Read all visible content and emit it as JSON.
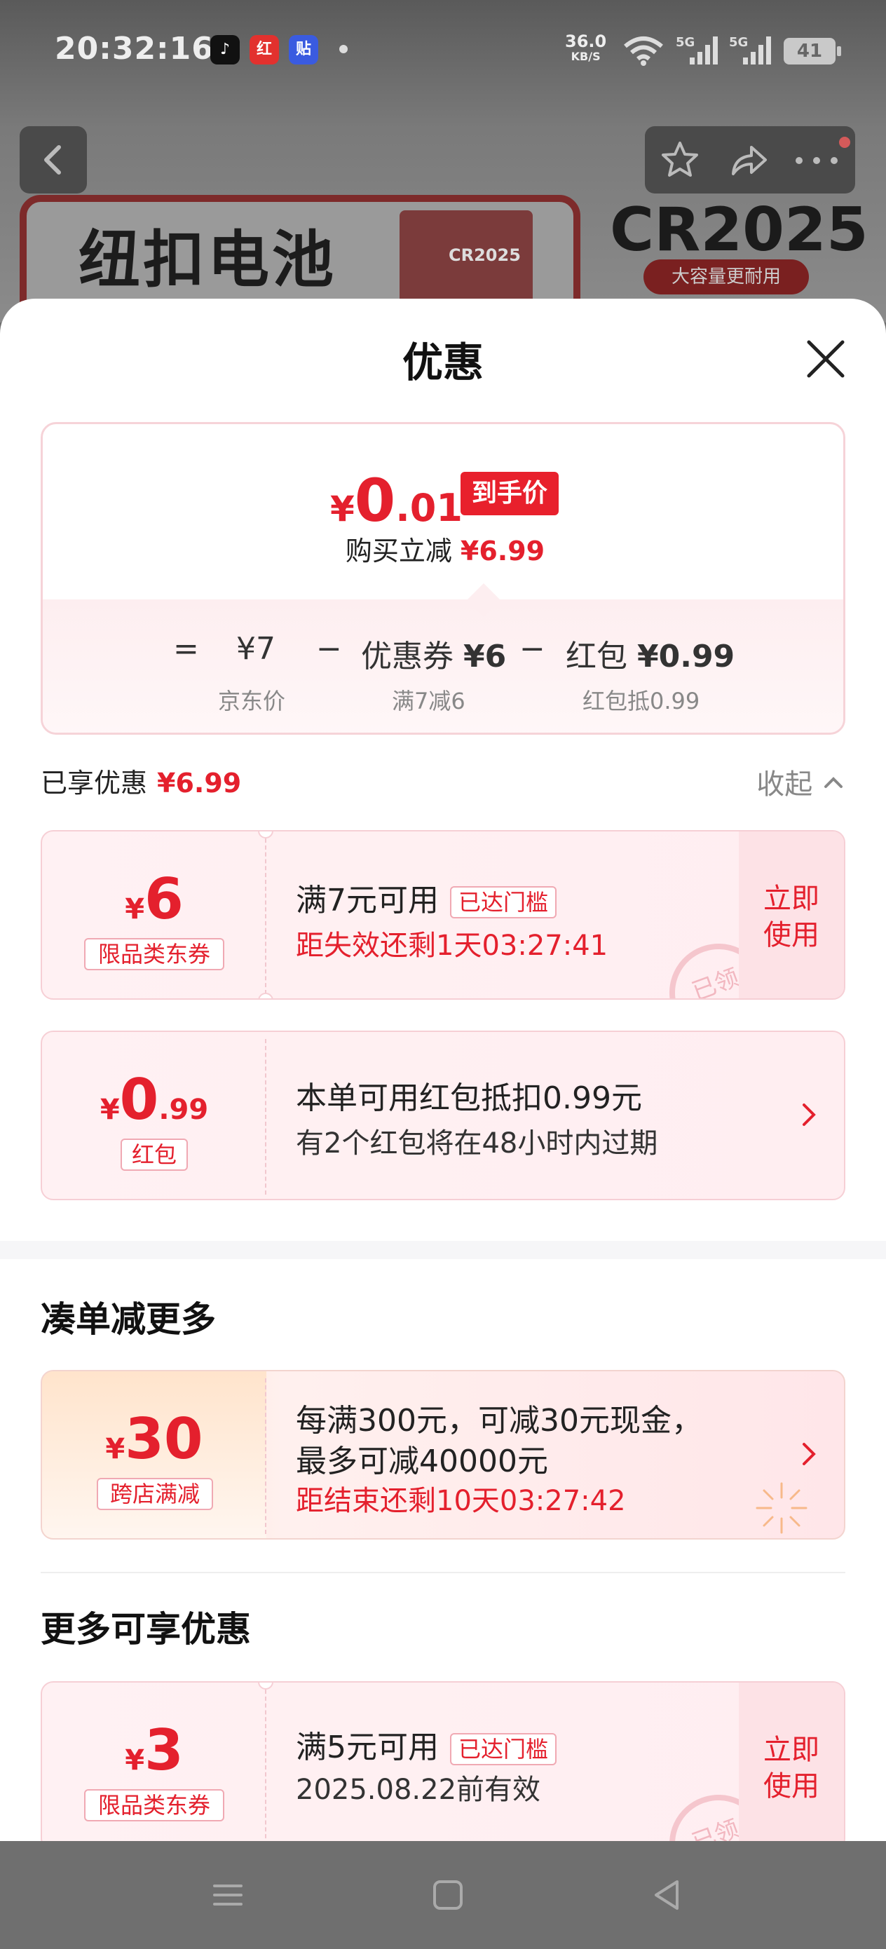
{
  "status_bar": {
    "time": "20:32:16",
    "apps": [
      {
        "name": "douyin-icon",
        "glyph": "♪",
        "color": "#111111"
      },
      {
        "name": "hongbao-app-icon",
        "glyph": "红",
        "color": "#e2312e"
      },
      {
        "name": "tie-app-icon",
        "glyph": "贴",
        "color": "#3a5be0"
      }
    ],
    "net_speed": "36.0",
    "net_unit": "KB/S",
    "sig1_label": "5G",
    "sig2_label": "5G",
    "battery": "41"
  },
  "background_page": {
    "product_title": "纽扣电池",
    "pack_label": "CR2025",
    "model": "CR2025",
    "badge": "大容量更耐用"
  },
  "sheet": {
    "title": "优惠",
    "price": {
      "currency": "¥",
      "int": "0",
      "dec": ".01",
      "tag": "到手价",
      "reduce_label": "购买立减",
      "reduce_amount": "¥6.99",
      "eq": "=",
      "jd_price": "¥7",
      "minus1": "−",
      "coupon_part": "优惠券",
      "coupon_amount": "¥6",
      "minus2": "−",
      "hongbao_part": "红包",
      "hongbao_amount": "¥0.99",
      "jd_price_label": "京东价",
      "coupon_label": "满7减6",
      "hongbao_label": "红包抵0.99"
    },
    "enjoyed": {
      "label": "已享优惠",
      "amount": "¥6.99",
      "collapse": "收起"
    },
    "coupons": [
      {
        "currency": "¥",
        "value": "6",
        "badge": "限品类东券",
        "main": "满7元可用",
        "tag": "已达门槛",
        "sub": "距失效还剩1天03:27:41",
        "use_line1": "立即",
        "use_line2": "使用",
        "stamp": "已领"
      },
      {
        "currency": "¥",
        "value": "0",
        "decimal": ".99",
        "badge": "红包",
        "main": "本单可用红包抵扣0.99元",
        "sub": "有2个红包将在48小时内过期"
      }
    ],
    "more_section": {
      "heading": "凑单减更多",
      "promo": {
        "currency": "¥",
        "value": "30",
        "badge": "跨店满减",
        "line1": "每满300元，可减30元现金，",
        "line2": "最多可减40000元",
        "sub": "距结束还剩10天03:27:42"
      }
    },
    "extra_section": {
      "heading": "更多可享优惠",
      "coupon": {
        "currency": "¥",
        "value": "3",
        "badge": "限品类东券",
        "main": "满5元可用",
        "tag": "已达门槛",
        "sub": "2025.08.22前有效",
        "use_line1": "立即",
        "use_line2": "使用",
        "stamp": "已领"
      }
    }
  },
  "colors": {
    "accent": "#e4202d",
    "coupon_bg": "#fff1f3",
    "nav_bg": "#6f6f6f"
  }
}
